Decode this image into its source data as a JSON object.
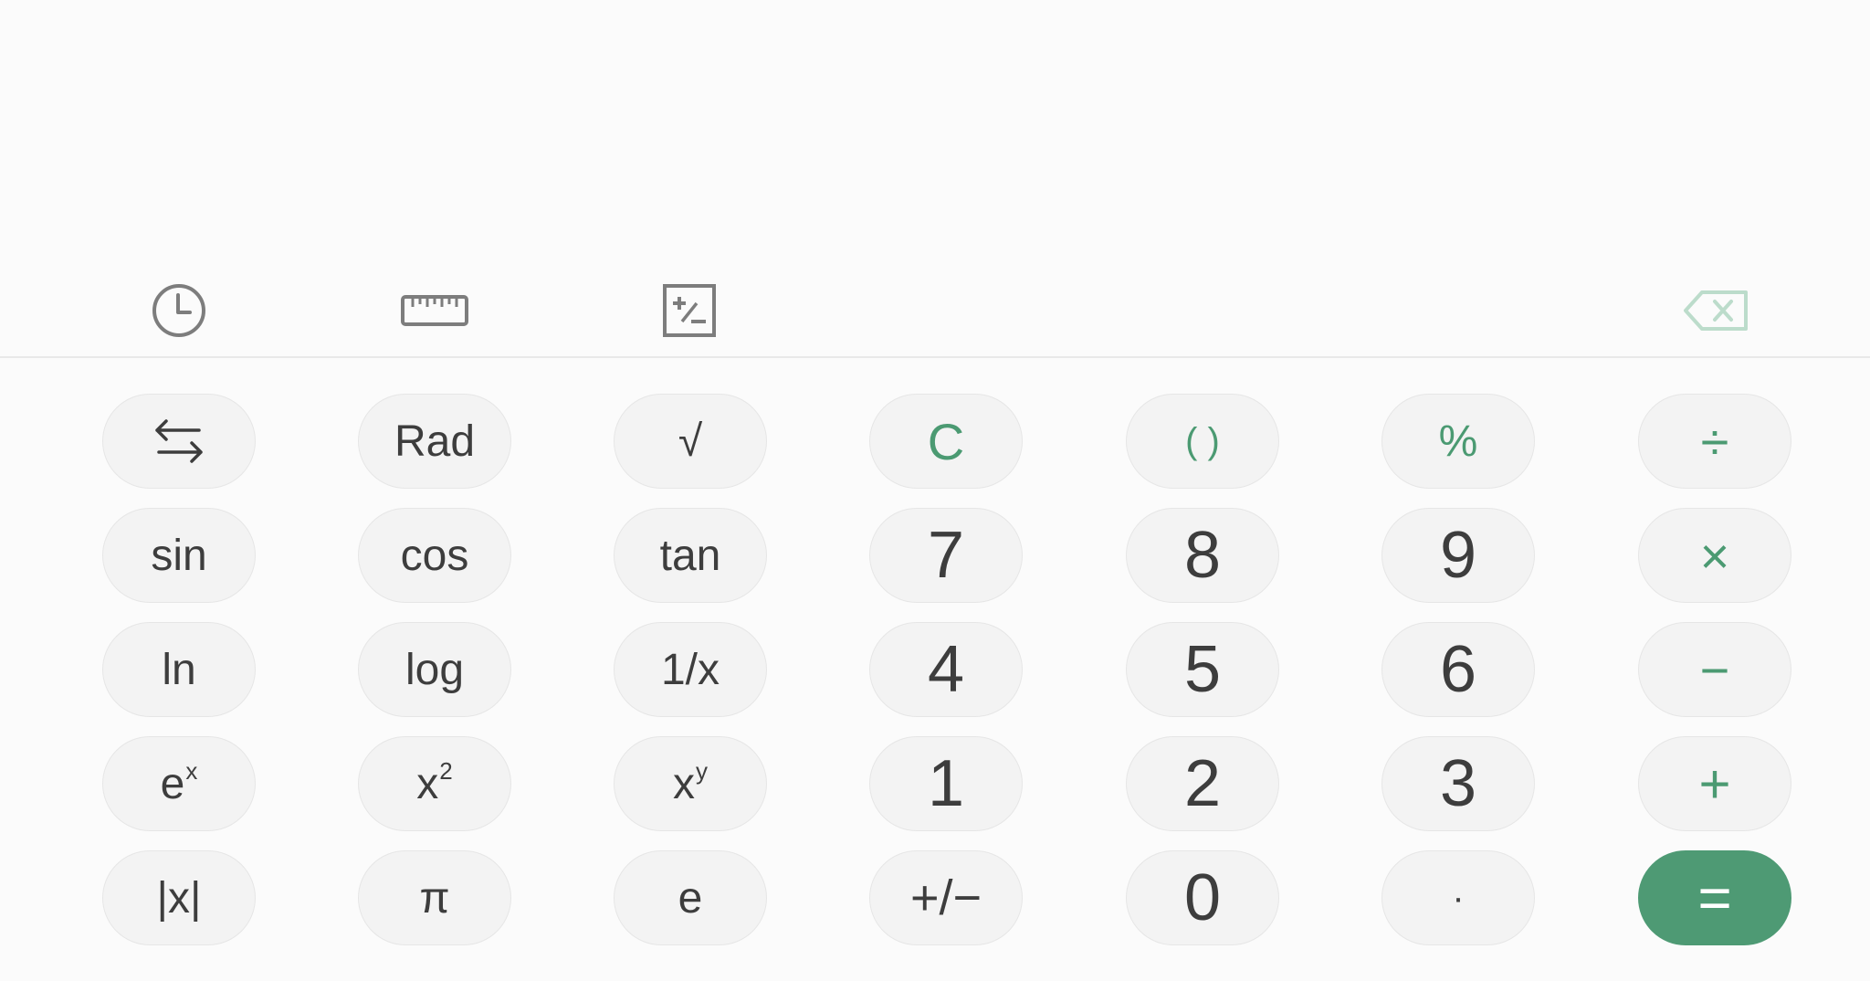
{
  "toolbar": {
    "history_icon": "clock-icon",
    "converter_icon": "ruler-icon",
    "scientific_toggle_icon": "plus-minus-box-icon",
    "backspace_icon": "backspace-icon"
  },
  "colors": {
    "accent": "#4e9a74",
    "key_background": "#f3f3f3",
    "key_text": "#3d3d3d",
    "background": "#fbfbfb"
  },
  "keys": {
    "swap_icon": "swap-arrows-icon",
    "rad": "Rad",
    "sqrt": "√",
    "clear": "C",
    "parens": "( )",
    "percent": "%",
    "divide": "÷",
    "sin": "sin",
    "cos": "cos",
    "tan": "tan",
    "seven": "7",
    "eight": "8",
    "nine": "9",
    "multiply": "×",
    "ln": "ln",
    "log": "log",
    "reciprocal": "1/x",
    "four": "4",
    "five": "5",
    "six": "6",
    "minus": "−",
    "exp_base": "e",
    "exp_sup": "x",
    "square_base": "x",
    "square_sup": "2",
    "power_base": "x",
    "power_sup": "y",
    "one": "1",
    "two": "2",
    "three": "3",
    "plus": "+",
    "abs": "|x|",
    "pi": "π",
    "e": "e",
    "negate": "+/−",
    "zero": "0",
    "decimal": "·",
    "equals": "="
  }
}
